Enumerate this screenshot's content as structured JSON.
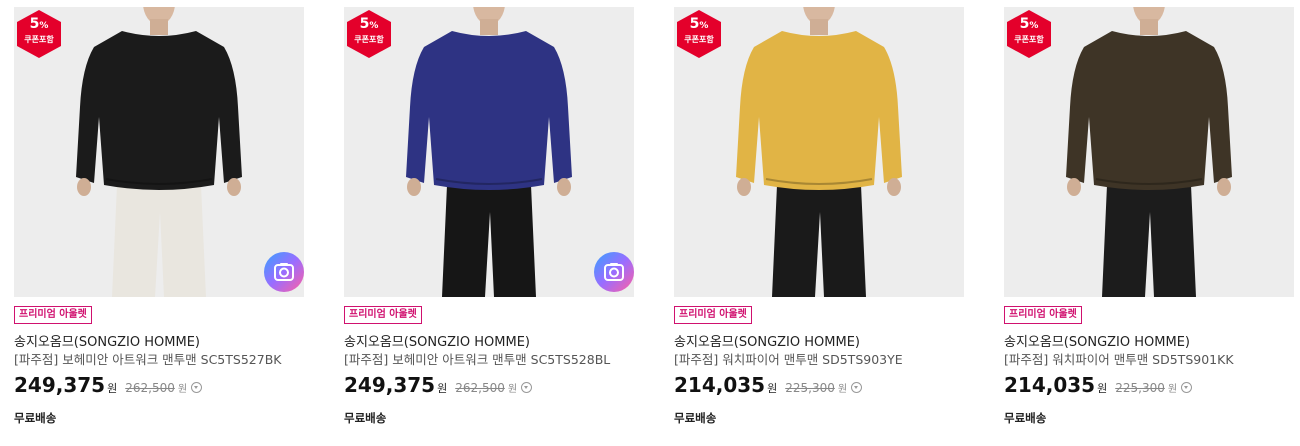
{
  "products": [
    {
      "coupon_percent": "5",
      "coupon_unit": "%",
      "coupon_text": "쿠폰포함",
      "badge": "프리미엄 아울렛",
      "brand": "송지오옴므(SONGZIO HOMME)",
      "name": "[파주점] 보헤미안 아트워크 맨투맨 SC5TS527BK",
      "price": "249,375",
      "price_unit": "원",
      "original_price": "262,500",
      "original_unit": "원",
      "shipping": "무료배송",
      "sweatshirt_color": "#1b1b1b",
      "pants_color": "#e9e6df",
      "has_snap_icon": true
    },
    {
      "coupon_percent": "5",
      "coupon_unit": "%",
      "coupon_text": "쿠폰포함",
      "badge": "프리미엄 아울렛",
      "brand": "송지오옴므(SONGZIO HOMME)",
      "name": "[파주점] 보헤미안 아트워크 맨투맨 SC5TS528BL",
      "price": "249,375",
      "price_unit": "원",
      "original_price": "262,500",
      "original_unit": "원",
      "shipping": "무료배송",
      "sweatshirt_color": "#2e3383",
      "pants_color": "#161616",
      "has_snap_icon": true
    },
    {
      "coupon_percent": "5",
      "coupon_unit": "%",
      "coupon_text": "쿠폰포함",
      "badge": "프리미엄 아울렛",
      "brand": "송지오옴므(SONGZIO HOMME)",
      "name": "[파주점] 워치파이어 맨투맨 SD5TS903YE",
      "price": "214,035",
      "price_unit": "원",
      "original_price": "225,300",
      "original_unit": "원",
      "shipping": "무료배송",
      "sweatshirt_color": "#e1b445",
      "pants_color": "#1a1a1a",
      "has_snap_icon": false
    },
    {
      "coupon_percent": "5",
      "coupon_unit": "%",
      "coupon_text": "쿠폰포함",
      "badge": "프리미엄 아울렛",
      "brand": "송지오옴므(SONGZIO HOMME)",
      "name": "[파주점] 워치파이어 맨투맨 SD5TS901KK",
      "price": "214,035",
      "price_unit": "원",
      "original_price": "225,300",
      "original_unit": "원",
      "shipping": "무료배송",
      "sweatshirt_color": "#3e3426",
      "pants_color": "#1c1c1c",
      "has_snap_icon": false
    }
  ],
  "colors": {
    "coupon_red": "#e4002b",
    "badge_magenta": "#d0116f",
    "thumb_bg": "#ededed"
  },
  "icons": {
    "coupon": "hexagon-coupon-icon",
    "snap": "camera-snap-icon",
    "info": "chevron-down-circle-icon"
  }
}
